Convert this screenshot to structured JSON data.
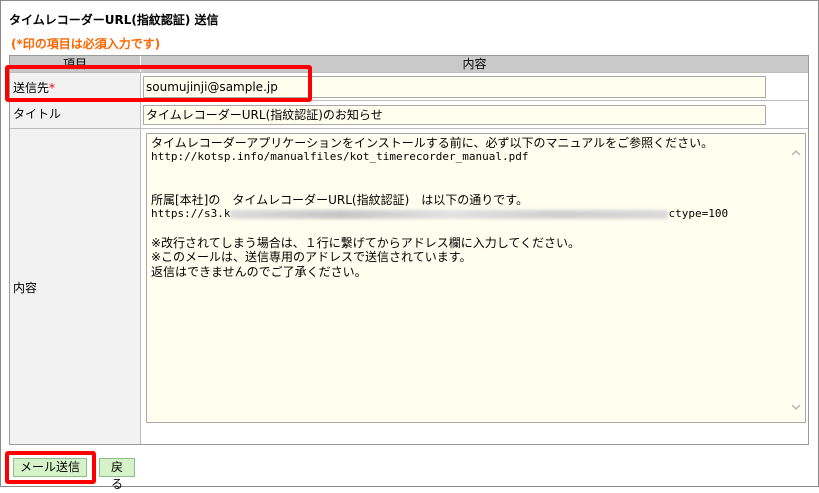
{
  "page": {
    "title": "タイムレコーダーURL(指紋認証) 送信",
    "required_note": "(*印の項目は必須入力です)"
  },
  "table": {
    "headers": [
      "項目",
      "内容"
    ],
    "rows": {
      "to": {
        "label": "送信先",
        "required_mark": "*",
        "value": "soumujinji@sample.jp"
      },
      "title": {
        "label": "タイトル",
        "value": "タイムレコーダーURL(指紋認証)のお知らせ"
      },
      "body": {
        "label": "内容",
        "lines": [
          "タイムレコーダーアプリケーションをインストールする前に、必ず以下のマニュアルをご参照ください。",
          "http://kotsp.info/manualfiles/kot_timerecorder_manual.pdf",
          "",
          "",
          "所属[本社]の　タイムレコーダーURL(指紋認証)　は以下の通りです。",
          "",
          "",
          "※改行されてしまう場合は、１行に繋げてからアドレス欄に入力してください。",
          "※このメールは、送信専用のアドレスで送信されています。",
          "返信はできませんのでご了承ください。"
        ],
        "url_prefix": "https://s3.k",
        "url_suffix": "ctype=100"
      }
    }
  },
  "buttons": {
    "send": "メール送信",
    "back": "戻る"
  },
  "icons": {
    "scroll_up": "chevron-up-icon",
    "scroll_down": "chevron-down-icon"
  },
  "colors": {
    "required": "#ff6600",
    "highlight": "#ff0000",
    "field_bg": "#fffff0",
    "button_bg": "#d6f2c8"
  }
}
